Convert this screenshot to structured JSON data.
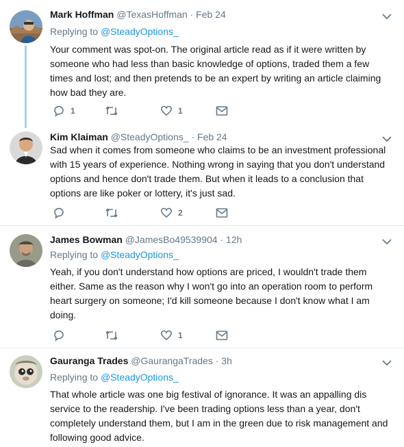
{
  "tweets": [
    {
      "name": "Mark Hoffman",
      "handle": "@TexasHoffman",
      "dot": "·",
      "time": "Feb 24",
      "replying_prefix": "Replying to ",
      "replying_to": "@SteadyOptions_",
      "text": "Your comment was spot-on. The original article read as if it were written by someone who had less than basic knowledge of options, traded them a few times and lost; and then pretends to be an expert by writing an article claiming how bad they are.",
      "replies": "1",
      "retweets": "",
      "likes": "1"
    },
    {
      "name": "Kim Klaiman",
      "handle": "@SteadyOptions_",
      "dot": "·",
      "time": "Feb 24",
      "replying_prefix": "",
      "replying_to": "",
      "text": "Sad when it comes from someone who claims to be an investment professional with 15 years of experience. Nothing wrong in saying that you don't understand options and hence don't trade them. But when it leads to a conclusion that options are like poker or lottery, it's just sad.",
      "replies": "",
      "retweets": "",
      "likes": "2"
    },
    {
      "name": "James Bowman",
      "handle": "@JamesBo49539904",
      "dot": "·",
      "time": "12h",
      "replying_prefix": "Replying to ",
      "replying_to": "@SteadyOptions_",
      "text": "Yeah, if you don't understand how options are priced, I wouldn't trade them either. Same as the reason why I won't go into an operation room to perform heart surgery on someone; I'd kill someone because I don't know what I am doing.",
      "replies": "",
      "retweets": "",
      "likes": "1"
    },
    {
      "name": "Gauranga Trades",
      "handle": "@GaurangaTrades",
      "dot": "·",
      "time": "3h",
      "replying_prefix": "Replying to ",
      "replying_to": "@SteadyOptions_",
      "text": "That whole article was one big festival of ignorance. It was an appalling dis service to the readership. I've been trading options less than a year, don't completely understand them, but I am in the green due to risk management and following good advice."
    }
  ],
  "icons": {
    "caret": "chevron-down-icon",
    "reply": "reply-icon",
    "retweet": "retweet-icon",
    "like": "heart-icon",
    "dm": "envelope-icon"
  },
  "colors": {
    "link": "#1b95e0",
    "muted": "#657786",
    "thread_line": "#9fd2f3",
    "separator": "#e6ecf0"
  }
}
